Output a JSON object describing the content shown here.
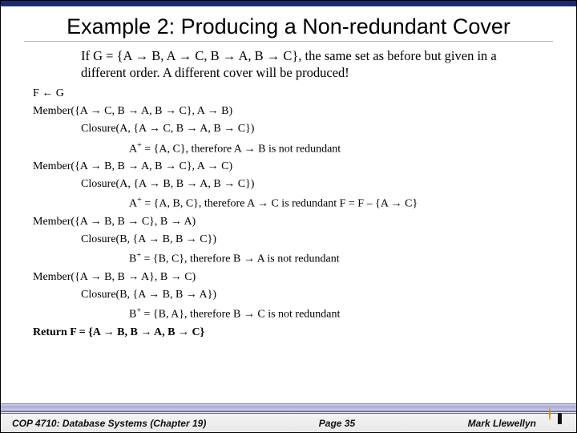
{
  "title": "Example 2: Producing a Non-redundant Cover",
  "intro": "If G = {A → B, A → C, B → A, B → C}, the same set as before but given in a different order. A different cover will be produced!",
  "lines": {
    "l1": "F ← G",
    "l2": "Member({A → C, B → A, B → C}, A → B)",
    "l3": "Closure(A, {A → C, B → A, B → C})",
    "l4a": "A",
    "l4b": " = {A, C}, therefore A → B is not redundant",
    "l5": "Member({A → B, B → A, B → C}, A → C)",
    "l6": "Closure(A, {A → B, B → A, B → C})",
    "l7a": "A",
    "l7b": " = {A, B, C}, therefore A → C is redundant F = F – {A → C}",
    "l8": "Member({A → B, B → C}, B → A)",
    "l9": "Closure(B, {A → B, B → C})",
    "l10a": "B",
    "l10b": " = {B, C}, therefore B → A is not redundant",
    "l11": "Member({A → B, B → A}, B → C)",
    "l12": "Closure(B, {A → B, B → A})",
    "l13a": "B",
    "l13b": " = {B, A}, therefore B → C is not redundant",
    "l14": "Return F = {A → B, B → A, B → C}"
  },
  "plus": "+",
  "footer": {
    "course": "COP 4710: Database Systems  (Chapter 19)",
    "page": "Page 35",
    "author": "Mark Llewellyn"
  }
}
